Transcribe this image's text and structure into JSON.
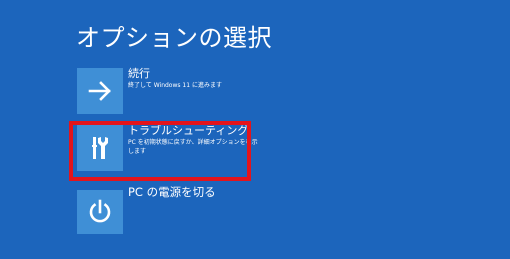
{
  "page": {
    "title": "オプションの選択",
    "background_color": "#1c65bc",
    "tile_color": "#3f8fd6",
    "highlight_color": "#e3141c"
  },
  "options": [
    {
      "icon": "arrow-right-icon",
      "label": "続行",
      "description": "終了して Windows 11 に進みます"
    },
    {
      "icon": "screwdriver-wrench-icon",
      "label": "トラブルシューティング",
      "description": "PC を初期状態に戻すか、詳細オプションを表示します"
    },
    {
      "icon": "power-icon",
      "label": "PC の電源を切る"
    }
  ]
}
